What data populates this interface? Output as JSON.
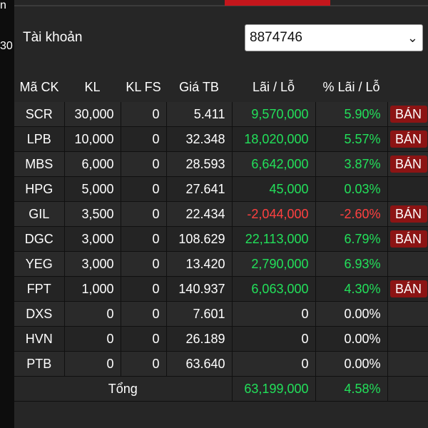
{
  "left_edge": {
    "text1": "n",
    "text2": "30"
  },
  "account": {
    "label": "Tài khoản",
    "selected": "8874746"
  },
  "table": {
    "headers": [
      "Mã CK",
      "KL",
      "KL FS",
      "Giá TB",
      "Lãi / Lỗ",
      "% Lãi / Lỗ"
    ],
    "rows": [
      {
        "symbol": "SCR",
        "qty": "30,000",
        "qty_fs": "0",
        "avg_price": "5.411",
        "pnl": "9,570,000",
        "pnl_pct": "5.90%",
        "sign": "pos",
        "sell": "BÁN"
      },
      {
        "symbol": "LPB",
        "qty": "10,000",
        "qty_fs": "0",
        "avg_price": "32.348",
        "pnl": "18,020,000",
        "pnl_pct": "5.57%",
        "sign": "pos",
        "sell": "BÁN"
      },
      {
        "symbol": "MBS",
        "qty": "6,000",
        "qty_fs": "0",
        "avg_price": "28.593",
        "pnl": "6,642,000",
        "pnl_pct": "3.87%",
        "sign": "pos",
        "sell": "BÁN"
      },
      {
        "symbol": "HPG",
        "qty": "5,000",
        "qty_fs": "0",
        "avg_price": "27.641",
        "pnl": "45,000",
        "pnl_pct": "0.03%",
        "sign": "pos",
        "sell": ""
      },
      {
        "symbol": "GIL",
        "qty": "3,500",
        "qty_fs": "0",
        "avg_price": "22.434",
        "pnl": "-2,044,000",
        "pnl_pct": "-2.60%",
        "sign": "neg",
        "sell": "BÁN"
      },
      {
        "symbol": "DGC",
        "qty": "3,000",
        "qty_fs": "0",
        "avg_price": "108.629",
        "pnl": "22,113,000",
        "pnl_pct": "6.79%",
        "sign": "pos",
        "sell": "BÁN"
      },
      {
        "symbol": "YEG",
        "qty": "3,000",
        "qty_fs": "0",
        "avg_price": "13.420",
        "pnl": "2,790,000",
        "pnl_pct": "6.93%",
        "sign": "pos",
        "sell": ""
      },
      {
        "symbol": "FPT",
        "qty": "1,000",
        "qty_fs": "0",
        "avg_price": "140.937",
        "pnl": "6,063,000",
        "pnl_pct": "4.30%",
        "sign": "pos",
        "sell": "BÁN"
      },
      {
        "symbol": "DXS",
        "qty": "0",
        "qty_fs": "0",
        "avg_price": "7.601",
        "pnl": "0",
        "pnl_pct": "0.00%",
        "sign": "neutral",
        "sell": ""
      },
      {
        "symbol": "HVN",
        "qty": "0",
        "qty_fs": "0",
        "avg_price": "26.189",
        "pnl": "0",
        "pnl_pct": "0.00%",
        "sign": "neutral",
        "sell": ""
      },
      {
        "symbol": "PTB",
        "qty": "0",
        "qty_fs": "0",
        "avg_price": "63.640",
        "pnl": "0",
        "pnl_pct": "0.00%",
        "sign": "neutral",
        "sell": ""
      }
    ],
    "total": {
      "label": "Tổng",
      "pnl": "63,199,000",
      "pnl_pct": "4.58%"
    }
  },
  "colors": {
    "positive": "#22e05a",
    "negative": "#ff4040",
    "sell_button": "#8c1414",
    "accent": "#c4161c"
  },
  "icons": {
    "select": "chevron-down-icon"
  }
}
